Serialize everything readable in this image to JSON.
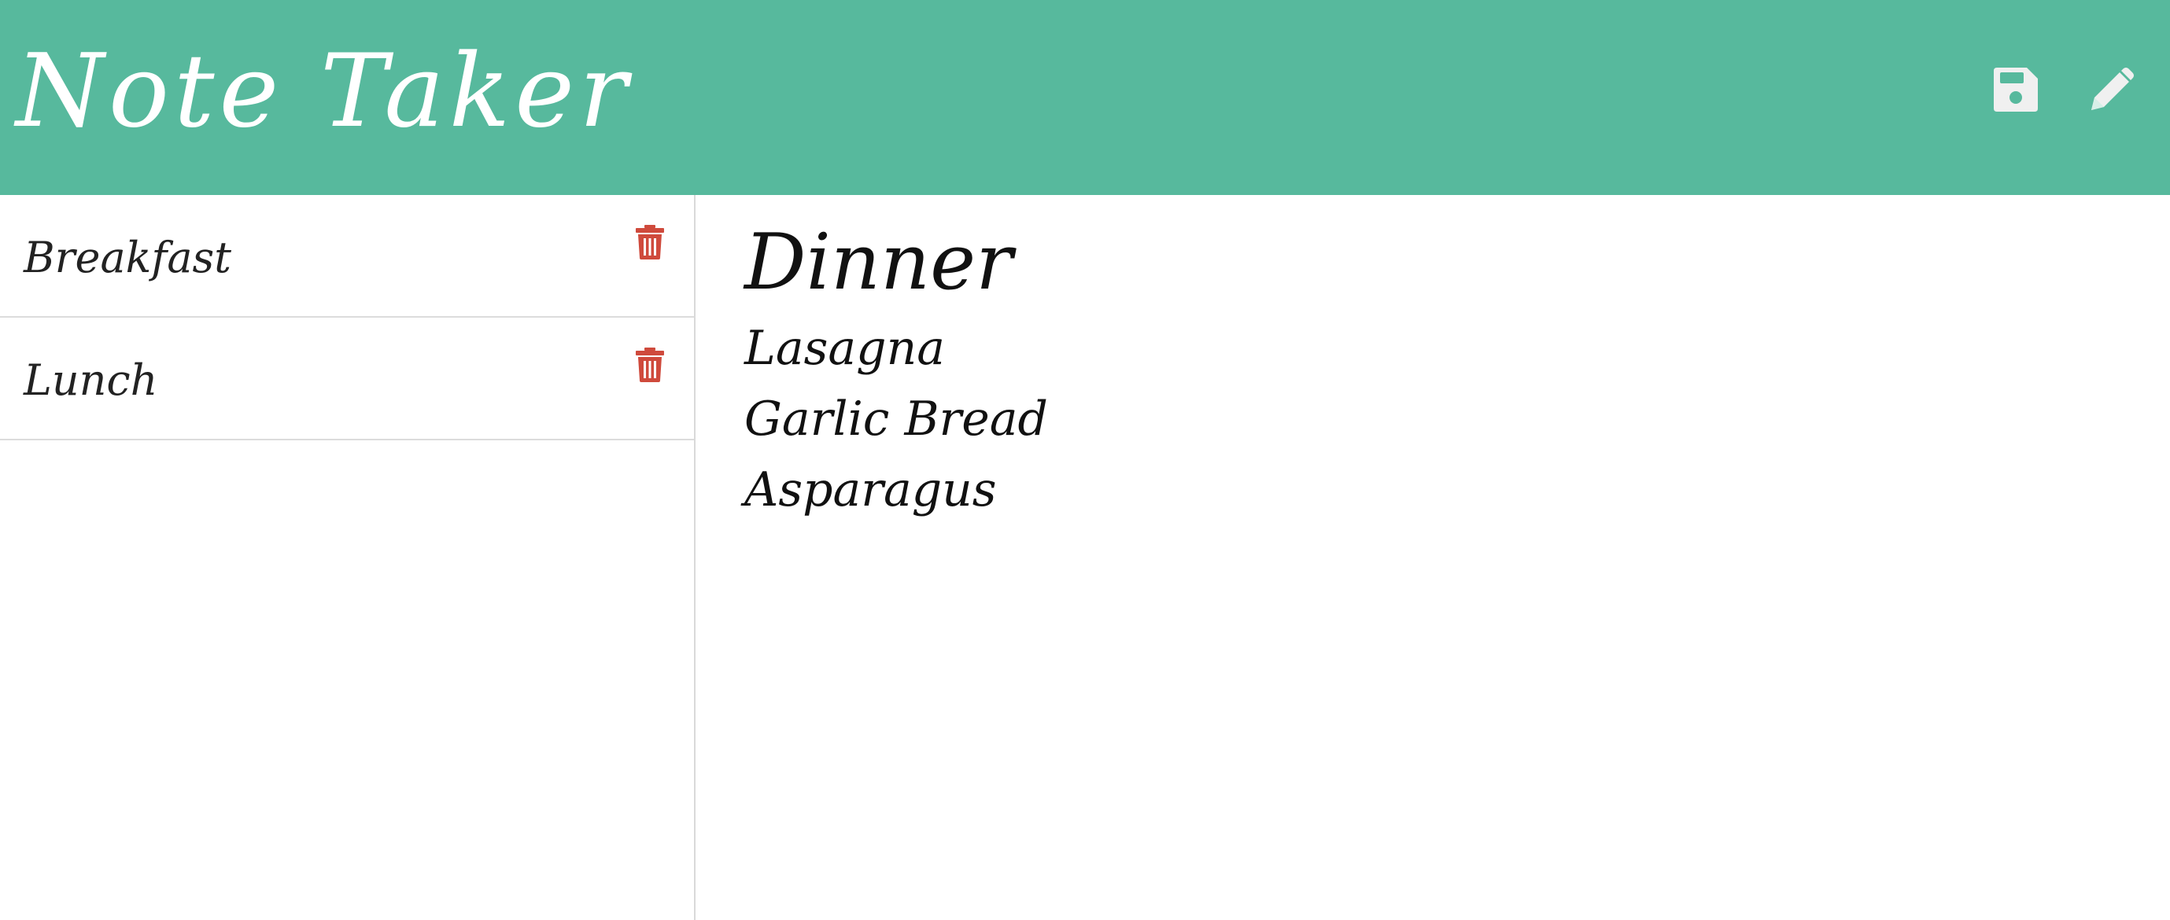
{
  "app": {
    "title": "Note Taker",
    "header_color": "#57b99d",
    "icon_color": "#f0f0f0",
    "delete_color": "#cf4a3c"
  },
  "toolbar": {
    "save_icon": "save-icon",
    "edit_icon": "pencil-icon"
  },
  "notes": [
    {
      "title": "Breakfast",
      "delete_icon": "trash-icon"
    },
    {
      "title": "Lunch",
      "delete_icon": "trash-icon"
    }
  ],
  "active_note": {
    "title": "Dinner",
    "lines": [
      "Lasagna",
      "Garlic Bread",
      "Asparagus"
    ]
  }
}
